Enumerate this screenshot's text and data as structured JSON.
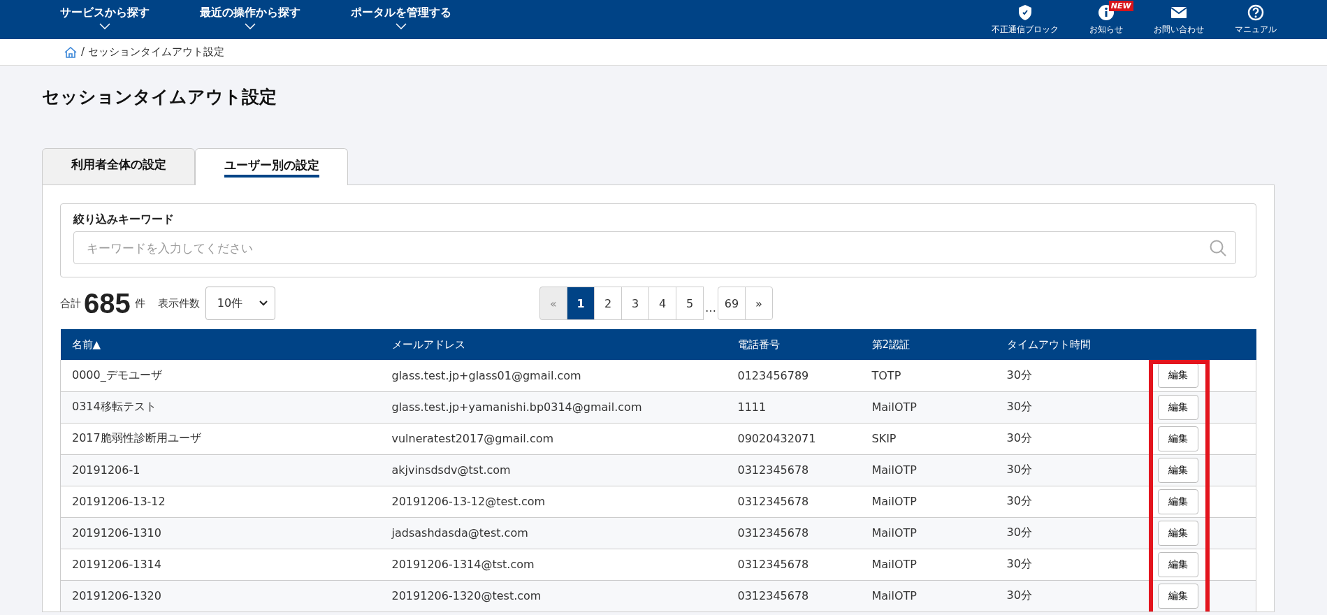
{
  "nav": {
    "menus": [
      {
        "label": "サービスから探す"
      },
      {
        "label": "最近の操作から探す"
      },
      {
        "label": "ポータルを管理する"
      }
    ],
    "utilities": [
      {
        "kind": "shield",
        "label": "不正通信ブロック"
      },
      {
        "kind": "info",
        "label": "お知らせ",
        "badge": "NEW"
      },
      {
        "kind": "mail",
        "label": "お問い合わせ"
      },
      {
        "kind": "help",
        "label": "マニュアル"
      }
    ]
  },
  "breadcrumb": {
    "current": "/ セッションタイムアウト設定"
  },
  "page_title": "セッションタイムアウト設定",
  "tabs": [
    {
      "label": "利用者全体の設定",
      "selected": false
    },
    {
      "label": "ユーザー別の設定",
      "selected": true
    }
  ],
  "filter": {
    "label": "絞り込みキーワード",
    "placeholder": "キーワードを入力してください"
  },
  "summary": {
    "total_label": "合計",
    "total": "685",
    "unit": "件",
    "per_page_label": "表示件数",
    "per_page": "10件"
  },
  "pagination": {
    "prev": "«",
    "next": "»",
    "ellipsis": "…",
    "pages": [
      {
        "label": "1",
        "selected": true
      },
      {
        "label": "2",
        "selected": false
      },
      {
        "label": "3",
        "selected": false
      },
      {
        "label": "4",
        "selected": false
      },
      {
        "label": "5",
        "selected": false
      }
    ],
    "last": {
      "label": "69",
      "selected": false
    }
  },
  "table": {
    "columns": [
      "名前▲",
      "メールアドレス",
      "電話番号",
      "第2認証",
      "タイムアウト時間"
    ],
    "rows": [
      {
        "cells": [
          "0000_デモユーザ",
          "glass.test.jp+glass01@gmail.com",
          "0123456789",
          "TOTP",
          "30分"
        ],
        "action": "編集"
      },
      {
        "cells": [
          "0314移転テスト",
          "glass.test.jp+yamanishi.bp0314@gmail.com",
          "1111",
          "MailOTP",
          "30分"
        ],
        "action": "編集"
      },
      {
        "cells": [
          "2017脆弱性診断用ユーザ",
          "vulneratest2017@gmail.com",
          "09020432071",
          "SKIP",
          "30分"
        ],
        "action": "編集"
      },
      {
        "cells": [
          "20191206-1",
          "akjvinsdsdv@tst.com",
          "0312345678",
          "MailOTP",
          "30分"
        ],
        "action": "編集"
      },
      {
        "cells": [
          "20191206-13-12",
          "20191206-13-12@test.com",
          "0312345678",
          "MailOTP",
          "30分"
        ],
        "action": "編集"
      },
      {
        "cells": [
          "20191206-1310",
          "jadsashdasda@test.com",
          "0312345678",
          "MailOTP",
          "30分"
        ],
        "action": "編集"
      },
      {
        "cells": [
          "20191206-1314",
          "20191206-1314@tst.com",
          "0312345678",
          "MailOTP",
          "30分"
        ],
        "action": "編集"
      },
      {
        "cells": [
          "20191206-1320",
          "20191206-1320@test.com",
          "0312345678",
          "MailOTP",
          "30分"
        ],
        "action": "編集"
      }
    ],
    "action_column_highlighted": true
  }
}
